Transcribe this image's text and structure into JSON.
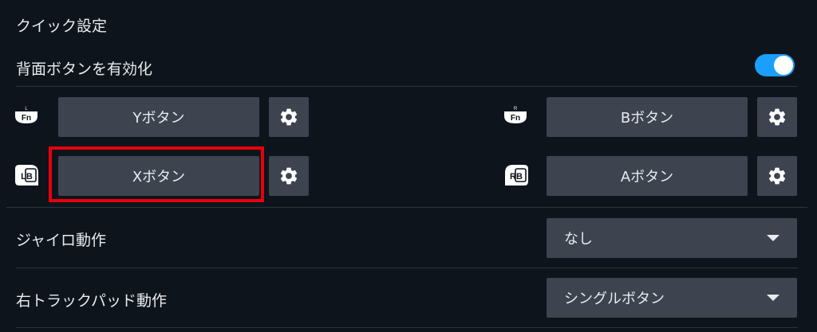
{
  "title": "クイック設定",
  "back_buttons": {
    "label": "背面ボタンを有効化",
    "toggle_on": true
  },
  "mappings": {
    "l_fn": {
      "badge_letter": "L",
      "badge_text": "Fn",
      "button_label": "Yボタン",
      "settings_icon": "gear-icon"
    },
    "r_fn": {
      "badge_letter": "R",
      "badge_text": "Fn",
      "button_label": "Bボタン",
      "settings_icon": "gear-icon"
    },
    "lb": {
      "badge_text": "LB",
      "button_label": "Xボタン",
      "settings_icon": "gear-icon"
    },
    "rb": {
      "badge_text": "RB",
      "button_label": "Aボタン",
      "settings_icon": "gear-icon"
    }
  },
  "gyro": {
    "label": "ジャイロ動作",
    "value": "なし"
  },
  "right_trackpad": {
    "label": "右トラックパッド動作",
    "value": "シングルボタン"
  },
  "colors": {
    "background": "#0e141b",
    "button": "#3d4450",
    "accent": "#1a9fff",
    "highlight": "#e8000b"
  }
}
